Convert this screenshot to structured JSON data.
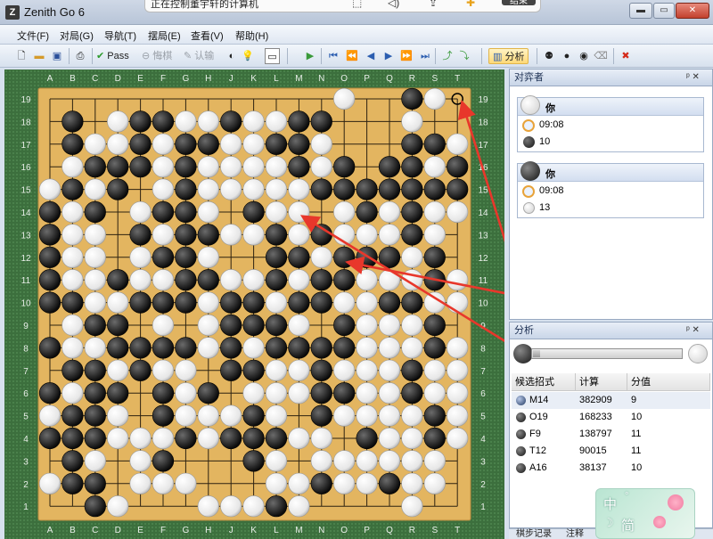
{
  "window": {
    "title": "Zenith Go 6",
    "remote_banner": "正在控制董宇轩的计算机",
    "remote_end": "结束",
    "minimize": "▬",
    "maximize": "▭",
    "close": "✕"
  },
  "menu": [
    "文件(F)",
    "对局(G)",
    "导航(T)",
    "摆局(E)",
    "查看(V)",
    "帮助(H)"
  ],
  "toolbar": {
    "pass": "Pass",
    "undo": "悔棋",
    "resign": "认输",
    "analysis": "分析"
  },
  "board": {
    "columns": [
      "A",
      "B",
      "C",
      "D",
      "E",
      "F",
      "G",
      "H",
      "J",
      "K",
      "L",
      "M",
      "N",
      "O",
      "P",
      "Q",
      "R",
      "S",
      "T"
    ],
    "rows": [
      ".............W..BW.",
      ".B.WBBWWBWWBB...W..",
      ".BWWBWBBWWBBW...BBW",
      ".WBBBWBWWWWBWB.BBWB",
      "WBWB.WBWWWWWBBBBBBB",
      "BWB.WBBW.BWW.WBWBWW",
      "BWW.BWBBWWBWBWWWBW.",
      "BWW.WBBW..BBWBBBWB.",
      "BWWBWWBBWWBWBBWWWBW",
      "BBWWBBBWBBWBBWWBBWW",
      ".WBB.W.WBBBW.BWWWB.",
      "BWWBBBBWBWBBBBWWWBW",
      ".BBWBWW.BBWWBWWWBWW",
      "BWBB.BWB.WWWBBWWBWW",
      "WBBW.BWWWBW.BWWWWBW",
      "BBBWWWBWBBBWW.BWWBW",
      ".BW.WB...BW.WWWWWW.",
      "WBB.WWW...WWBWWBWW.",
      "..BW...WWWBW....W.."
    ],
    "last_move": "T19",
    "arrows": [
      {
        "from": "T19",
        "to": "W6"
      },
      {
        "from": "M14",
        "to": "W7"
      },
      {
        "from": "O12",
        "to": "W10"
      }
    ]
  },
  "opponents_panel": {
    "title": "对弈者",
    "pin": "ᵖ ✕",
    "white": {
      "name": "你",
      "time": "09:08",
      "captures": "10",
      "captures_color": "black"
    },
    "black": {
      "name": "你",
      "time": "09:08",
      "captures": "13",
      "captures_color": "white"
    }
  },
  "analysis_panel": {
    "title": "分析",
    "pin": "ᵖ ✕",
    "black_share": 0.05,
    "headers": [
      "候选招式",
      "计算",
      "分值"
    ],
    "rows": [
      {
        "move": "M14",
        "calc": "382909",
        "score": "9"
      },
      {
        "move": "O19",
        "calc": "168233",
        "score": "10"
      },
      {
        "move": "F9",
        "calc": "138797",
        "score": "11"
      },
      {
        "move": "T12",
        "calc": "90015",
        "score": "11"
      },
      {
        "move": "A16",
        "calc": "38137",
        "score": "10"
      }
    ]
  },
  "bottom_tabs": [
    "棋步记录",
    "注释"
  ],
  "ime": {
    "lang": "中",
    "mode": "简",
    "moon": "☽",
    "dot": "°"
  },
  "colors": {
    "board": "#e3b560",
    "board_bg": "#3c6f3d",
    "arrow": "#e8372b"
  }
}
